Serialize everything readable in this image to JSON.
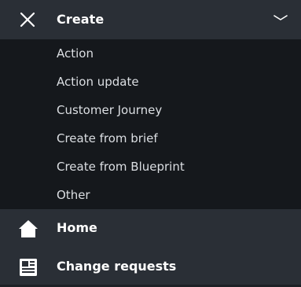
{
  "create_menu": {
    "title": "Create",
    "close_icon": "close-icon",
    "toggle_icon": "chevron-down-icon",
    "items": [
      {
        "label": "Action"
      },
      {
        "label": "Action update"
      },
      {
        "label": "Customer Journey"
      },
      {
        "label": "Create from brief"
      },
      {
        "label": "Create from Blueprint"
      },
      {
        "label": "Other"
      }
    ]
  },
  "nav": {
    "items": [
      {
        "label": "Home",
        "icon": "home-icon"
      },
      {
        "label": "Change requests",
        "icon": "document-icon"
      }
    ]
  },
  "colors": {
    "panel_bg": "#2a2f36",
    "submenu_bg": "#15181c",
    "text_primary": "#ffffff",
    "text_secondary": "#dcdfe3"
  }
}
